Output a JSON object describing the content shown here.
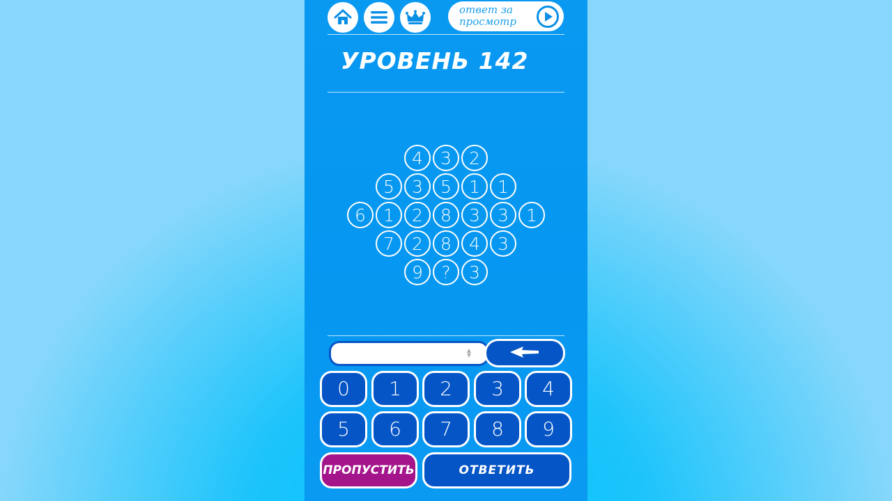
{
  "header": {
    "watch_answer_label": "ответ за просмотр",
    "icons": [
      "home-icon",
      "menu-icon",
      "crown-icon",
      "play-icon"
    ]
  },
  "level": {
    "title": "УРОВЕНЬ 142"
  },
  "puzzle": {
    "rows": [
      [
        "4",
        "3",
        "2"
      ],
      [
        "5",
        "3",
        "5",
        "1",
        "1"
      ],
      [
        "6",
        "1",
        "2",
        "8",
        "3",
        "3",
        "1"
      ],
      [
        "7",
        "2",
        "8",
        "4",
        "3"
      ],
      [
        "9",
        "?",
        "3"
      ]
    ]
  },
  "input": {
    "value": "",
    "placeholder": ""
  },
  "keypad": {
    "keys": [
      "0",
      "1",
      "2",
      "3",
      "4",
      "5",
      "6",
      "7",
      "8",
      "9"
    ]
  },
  "actions": {
    "skip_label": "ПРОПУСТИТЬ",
    "answer_label": "ОТВЕТИТЬ"
  },
  "colors": {
    "panel_blue": "#0597f1",
    "key_blue": "#0555c6",
    "skip_purple": "#a4158c",
    "outer_cyan": "#00c2fb"
  }
}
